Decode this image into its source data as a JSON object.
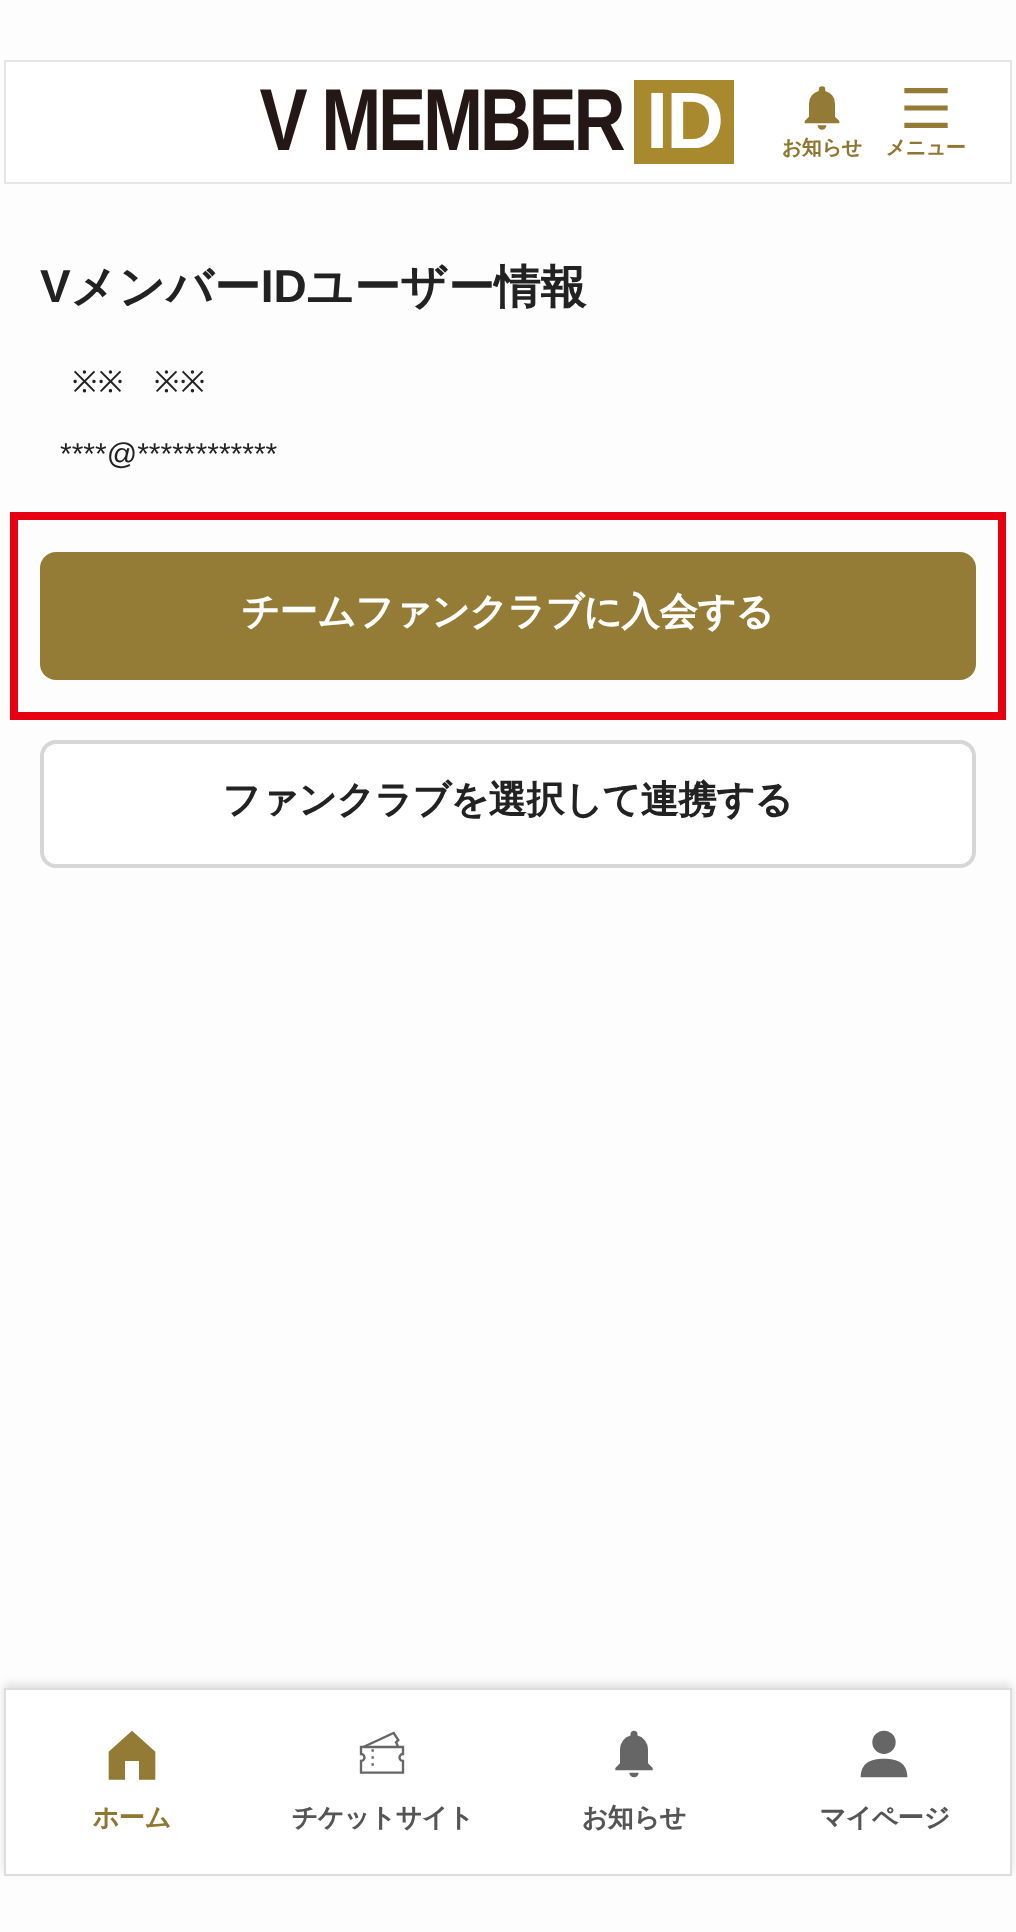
{
  "header": {
    "logo": {
      "text": "V MEMBER",
      "badge": "ID"
    },
    "actions": [
      {
        "kind": "bell",
        "label": "お知らせ"
      },
      {
        "kind": "menu",
        "label": "メニュー"
      }
    ]
  },
  "user_info": {
    "title": "VメンバーIDユーザー情報",
    "name": "※※　※※",
    "email": "****@************"
  },
  "buttons": [
    {
      "label": "チームファンクラブに入会する",
      "kind": "primary",
      "highlighted": true
    },
    {
      "label": "ファンクラブを選択して連携する",
      "kind": "secondary",
      "highlighted": false
    }
  ],
  "bottom_nav": [
    {
      "kind": "home",
      "label": "ホーム",
      "selected": true
    },
    {
      "kind": "ticket",
      "label": "チケットサイト",
      "selected": false
    },
    {
      "kind": "bell",
      "label": "お知らせ",
      "selected": false
    },
    {
      "kind": "person",
      "label": "マイページ",
      "selected": false
    }
  ]
}
